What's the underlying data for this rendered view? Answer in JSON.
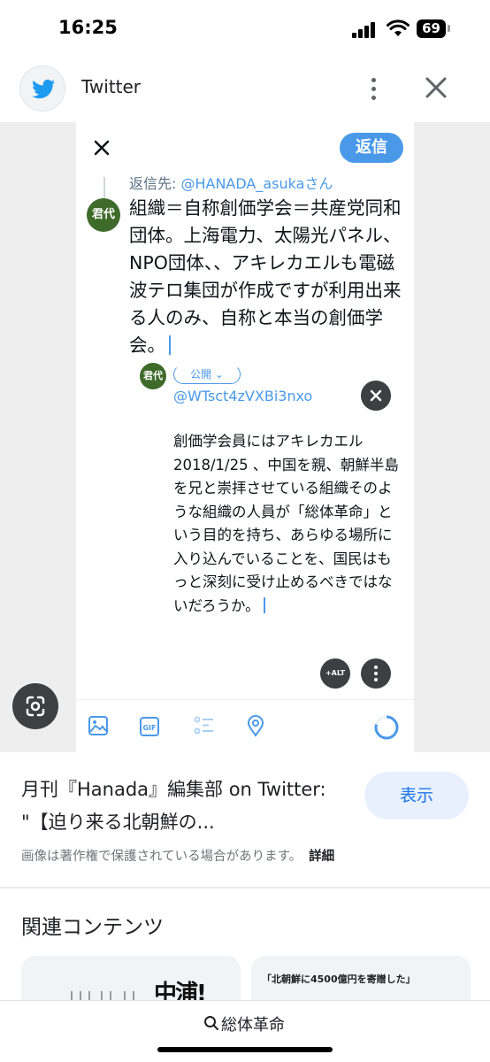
{
  "status_bar": {
    "time": "16:25",
    "battery": "69"
  },
  "viewer": {
    "site_name": "Twitter",
    "site_icon": "twitter-bird-icon"
  },
  "tweet_compose": {
    "reply_button": "返信",
    "reply_to_label": "返信先: ",
    "reply_to_handle": "@HANADA_asukaさん",
    "avatar_text": "君代",
    "main_text": "組織＝自称創価学会＝共産党同和団体。上海電力、太陽光パネル、NPO団体、、アキレカエルも電磁波テロ集団が作成ですが利用出来る人のみ、自称と本当の創価学会。",
    "audience_chip": "公開 ⌄",
    "quoted_handle": "@WTsct4zVXBi3nxo",
    "quote_text": "創価学会員にはアキレカエル2018/1/25 、中国を親、朝鮮半島を兄と崇拝させている組織そのような組織の人員が「総体革命」という目的を持ち、あらゆる場所に入り込んでいることを、国民はもっと深刻に受け止めるべきではないだろうか。",
    "alt_button": "+ALT",
    "gif_label": "GIF",
    "accent_color": "#4a99e9"
  },
  "result": {
    "title": "月刊『Hanada』編集部 on Twitter: \"【迫り来る北朝鮮の...",
    "visit_button": "表示",
    "copyright_note": "画像は著作権で保護されている場合があります。",
    "details_link": "詳細"
  },
  "related": {
    "heading": "関連コンテンツ",
    "card_1_text": "中浦!",
    "card_2_text": "「北朝鮮に4500億円を寄贈した」"
  },
  "search": {
    "query": "総体革命"
  }
}
